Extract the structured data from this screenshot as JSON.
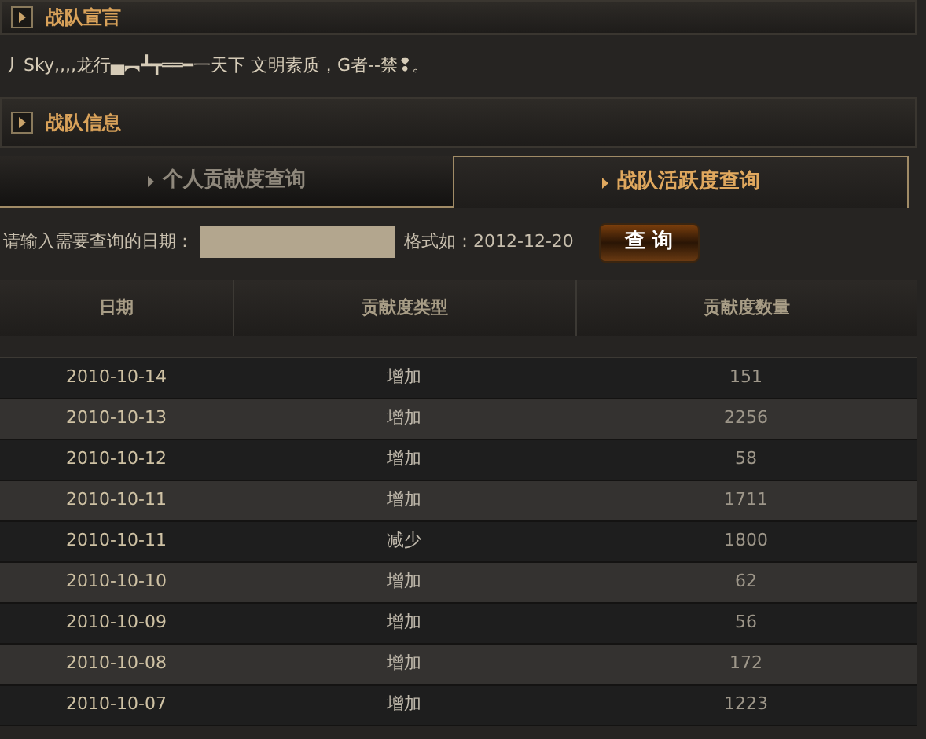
{
  "sections": [
    {
      "title": "战队宣言"
    },
    {
      "title": "战队信息"
    }
  ],
  "declaration": "丿Sky,,,,龙行▄︻┻┳══━一天下 文明素质，G者--禁❢。",
  "tabs": [
    {
      "label": "个人贡献度查询",
      "selected": false
    },
    {
      "label": "战队活跃度查询",
      "selected": true
    }
  ],
  "query": {
    "label": "请输入需要查询的日期：",
    "hint": "格式如：2012-12-20",
    "button": "查 询"
  },
  "table": {
    "columns": [
      "日期",
      "贡献度类型",
      "贡献度数量"
    ],
    "rows": [
      [
        "2010-10-14",
        "增加",
        "151"
      ],
      [
        "2010-10-13",
        "增加",
        "2256"
      ],
      [
        "2010-10-12",
        "增加",
        "58"
      ],
      [
        "2010-10-11",
        "增加",
        "1711"
      ],
      [
        "2010-10-11",
        "减少",
        "1800"
      ],
      [
        "2010-10-10",
        "增加",
        "62"
      ],
      [
        "2010-10-09",
        "增加",
        "56"
      ],
      [
        "2010-10-08",
        "增加",
        "172"
      ],
      [
        "2010-10-07",
        "增加",
        "1223"
      ]
    ]
  }
}
